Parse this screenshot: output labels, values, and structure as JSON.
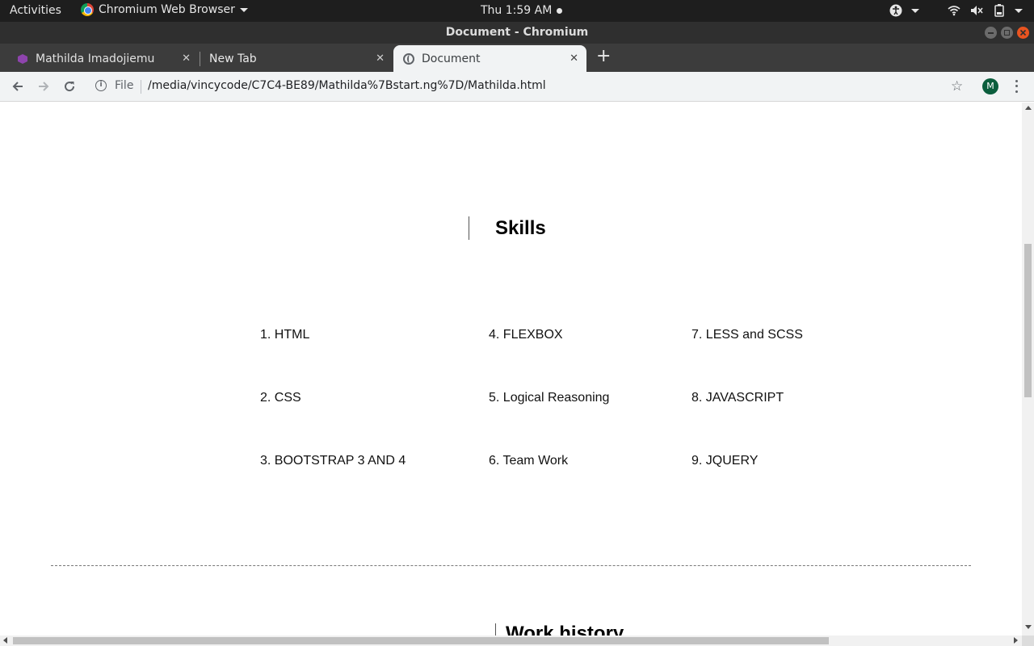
{
  "system_bar": {
    "activities": "Activities",
    "app_name": "Chromium Web Browser",
    "clock": "Thu  1:59 AM"
  },
  "window": {
    "title": "Document - Chromium"
  },
  "tabs": [
    {
      "label": "Mathilda Imadojiemu - Lu",
      "active": false
    },
    {
      "label": "New Tab",
      "active": false
    },
    {
      "label": "Document",
      "active": true
    }
  ],
  "toolbar": {
    "scheme_label": "File",
    "url": "/media/vincycode/C7C4-BE89/Mathilda%7Bstart.ng%7D/Mathilda.html",
    "profile_initial": "M"
  },
  "page": {
    "skills_heading": "Skills",
    "skills": [
      "1. HTML",
      "2. CSS",
      "3. BOOTSTRAP 3 AND 4",
      "4. FLEXBOX",
      "5. Logical Reasoning",
      "6. Team Work",
      "7. LESS and SCSS",
      "8. JAVASCRIPT",
      "9. JQUERY"
    ],
    "work_heading": "Work history"
  },
  "colors": {
    "accent_close": "#e95420",
    "profile_avatar": "#0b5e3d",
    "tab_favicon": "#8e44ad"
  }
}
